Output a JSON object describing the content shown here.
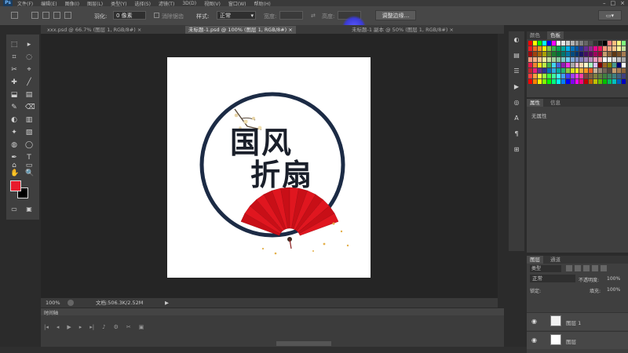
{
  "menubar": {
    "logo": "Ps",
    "items": [
      "文件(F)",
      "编辑(E)",
      "图像(I)",
      "图层(L)",
      "类型(Y)",
      "选择(S)",
      "滤镜(T)",
      "3D(D)",
      "视图(V)",
      "窗口(W)",
      "帮助(H)"
    ],
    "window_controls": [
      "–",
      "□",
      "×"
    ]
  },
  "options": {
    "feather_label": "羽化:",
    "feather_value": "0 像素",
    "antialias_label": "消除锯齿",
    "style_label": "样式:",
    "style_value": "正常",
    "width_label": "宽度:",
    "height_label": "高度:",
    "refine_label": "调整边缘..."
  },
  "tabs": [
    {
      "label": "xxx.psd @ 66.7% (图层 1, RGB/8#) ×",
      "active": false
    },
    {
      "label": "未标题-1.psd @ 100% (图层 1, RGB/8#) ×",
      "active": true
    },
    {
      "label": "未标题-1 副本 @ 50% (图层 1, RGB/8#) ×",
      "active": false
    }
  ],
  "toolbar": {
    "tools_left": [
      "⬚",
      "⌗",
      "✂",
      "✚",
      "⬓",
      "✎",
      "◐",
      "✦",
      "◍",
      "✒",
      "⌂",
      "✋"
    ],
    "tools_right": [
      "▸",
      "◌",
      "⌖",
      "╱",
      "▤",
      "⌫",
      "▥",
      "▧",
      "◯",
      "T",
      "▭",
      "🔍"
    ],
    "fg_color": "#e81c2c",
    "bg_color": "#000000"
  },
  "artwork": {
    "line1": "国风",
    "line2": "折扇",
    "ring_color": "#1c2b45",
    "text_color": "#1a1f2a",
    "fan_color": "#e0161f"
  },
  "status": {
    "zoom": "100%",
    "doc_info": "文档:506.3K/2.52M"
  },
  "timeline": {
    "title": "时间轴",
    "controls": [
      "|◂",
      "◂",
      "▶",
      "▸",
      "▸|",
      "♪",
      "⚙",
      "✂",
      "▣"
    ]
  },
  "right_dock": {
    "icons": [
      "◐",
      "▤",
      "☰",
      "▶",
      "◎",
      "A",
      "¶",
      "⊞"
    ]
  },
  "swatches_panel": {
    "tabs": [
      "颜色",
      "色板"
    ],
    "active_tab": 1,
    "colors": [
      "#ff0000",
      "#ffff00",
      "#00ff00",
      "#00ffff",
      "#0000ff",
      "#ff00ff",
      "#ffffff",
      "#e6e6e6",
      "#cccccc",
      "#b3b3b3",
      "#999999",
      "#808080",
      "#666666",
      "#4d4d4d",
      "#333333",
      "#1a1a1a",
      "#000000",
      "#ff7f7f",
      "#ffbf7f",
      "#ffff7f",
      "#7fff7f",
      "#ed1c24",
      "#f26522",
      "#f7941d",
      "#fff200",
      "#8dc63f",
      "#39b54a",
      "#00a651",
      "#00a99d",
      "#00aeef",
      "#0072bc",
      "#0054a6",
      "#2e3192",
      "#662d91",
      "#92278f",
      "#ec008c",
      "#ed145b",
      "#f69679",
      "#f9ad81",
      "#fdc68a",
      "#fff799",
      "#c4df9b",
      "#9e0b0f",
      "#a0410d",
      "#a36209",
      "#aba000",
      "#598527",
      "#1a7b30",
      "#007236",
      "#00746b",
      "#0076a3",
      "#004b80",
      "#003471",
      "#1b1464",
      "#440e62",
      "#630460",
      "#9e005d",
      "#9e0039",
      "#c69c6d",
      "#8c6239",
      "#603913",
      "#754c24",
      "#a67c52",
      "#f7977a",
      "#fbad82",
      "#fdc68c",
      "#fff79a",
      "#c4df9b",
      "#a3d39c",
      "#82ca9c",
      "#7accc8",
      "#6dcff6",
      "#7da7d8",
      "#8493ca",
      "#8781bd",
      "#a187be",
      "#bc8dbf",
      "#f49ac2",
      "#f6989d",
      "#ffffff",
      "#f2f2f2",
      "#d9d9d9",
      "#bfbfbf",
      "#a6a6a6",
      "#e6194b",
      "#f58231",
      "#ffe119",
      "#bfef45",
      "#3cb44b",
      "#42d4f4",
      "#4363d8",
      "#911eb4",
      "#f032e6",
      "#a9a9a9",
      "#fabed4",
      "#ffd8b1",
      "#fffac8",
      "#aaffc3",
      "#dcbeff",
      "#800000",
      "#9a6324",
      "#808000",
      "#469990",
      "#000075",
      "#ffffff",
      "#c1272d",
      "#ed1e79",
      "#662d91",
      "#2e3192",
      "#0071bc",
      "#29abe2",
      "#00a99d",
      "#22b573",
      "#8cc63f",
      "#d9e021",
      "#fcee21",
      "#fbb03b",
      "#f7931e",
      "#f15a24",
      "#c7b299",
      "#998675",
      "#736357",
      "#534741",
      "#c69c6d",
      "#a67c52",
      "#8c6239",
      "#ff4040",
      "#ff9f40",
      "#ffff40",
      "#9fff40",
      "#40ff40",
      "#40ff9f",
      "#40ffff",
      "#409fff",
      "#4040ff",
      "#9f40ff",
      "#ff40ff",
      "#ff409f",
      "#804040",
      "#806040",
      "#808040",
      "#608040",
      "#408040",
      "#408060",
      "#408080",
      "#406080",
      "#404080",
      "#ff0000",
      "#ff8000",
      "#ffff00",
      "#80ff00",
      "#00ff00",
      "#00ff80",
      "#00ffff",
      "#0080ff",
      "#0000ff",
      "#8000ff",
      "#ff00ff",
      "#ff0080",
      "#c00000",
      "#c06000",
      "#c0c000",
      "#60c000",
      "#00c000",
      "#00c060",
      "#00c0c0",
      "#0060c0",
      "#0000c0"
    ]
  },
  "props_panel": {
    "tabs": [
      "属性",
      "信息"
    ],
    "active_tab": 0,
    "subtitle": "无属性"
  },
  "layers_panel": {
    "tabs": [
      "图层",
      "通道"
    ],
    "active_tab": 0,
    "kind_label": "类型",
    "blend_mode": "正常",
    "opacity_label": "不透明度:",
    "opacity_value": "100%",
    "lock_label": "锁定:",
    "fill_label": "填充:",
    "fill_value": "100%",
    "layers": [
      {
        "name": "图层 1",
        "visible": true
      },
      {
        "name": "图层",
        "visible": true
      }
    ]
  }
}
